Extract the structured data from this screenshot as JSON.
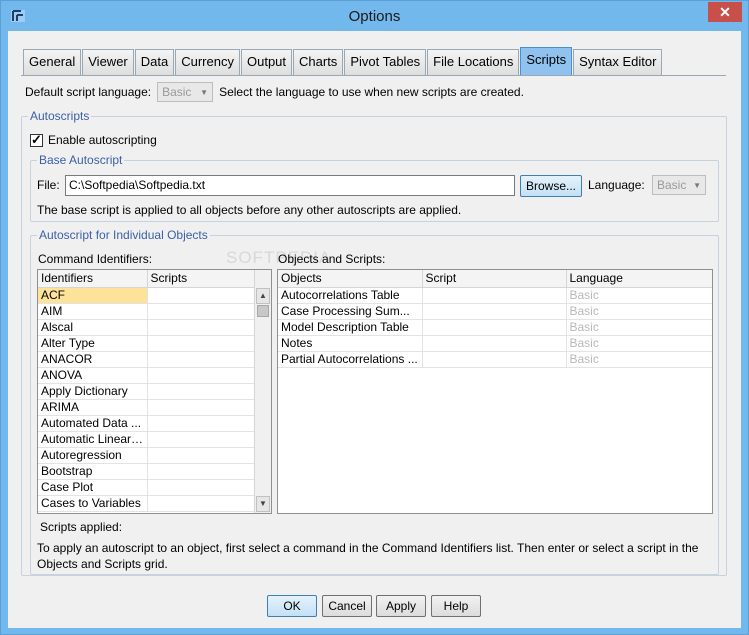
{
  "window": {
    "title": "Options",
    "close_symbol": "✕"
  },
  "tabs": [
    "General",
    "Viewer",
    "Data",
    "Currency",
    "Output",
    "Charts",
    "Pivot Tables",
    "File Locations",
    "Scripts",
    "Syntax Editor"
  ],
  "active_tab": "Scripts",
  "default_script": {
    "label": "Default script language:",
    "value": "Basic",
    "hint": "Select the language to use when new scripts are created."
  },
  "autoscripts": {
    "group_label": "Autoscripts",
    "enable_label": "Enable autoscripting",
    "enabled": true
  },
  "base_autoscript": {
    "group_label": "Base Autoscript",
    "file_label": "File:",
    "file_value": "C:\\Softpedia\\Softpedia.txt",
    "browse_label": "Browse...",
    "language_label": "Language:",
    "language_value": "Basic",
    "note": "The base script is applied to all objects before any other autoscripts are applied."
  },
  "individual": {
    "group_label": "Autoscript for Individual Objects",
    "cmd_label": "Command Identifiers:",
    "cmd_columns": [
      "Identifiers",
      "Scripts"
    ],
    "cmd_rows": [
      {
        "id": "ACF",
        "script": ""
      },
      {
        "id": "AIM",
        "script": ""
      },
      {
        "id": "Alscal",
        "script": ""
      },
      {
        "id": "Alter Type",
        "script": ""
      },
      {
        "id": "ANACOR",
        "script": ""
      },
      {
        "id": "ANOVA",
        "script": ""
      },
      {
        "id": "Apply Dictionary",
        "script": ""
      },
      {
        "id": "ARIMA",
        "script": ""
      },
      {
        "id": "Automated Data ...",
        "script": ""
      },
      {
        "id": "Automatic Linear ...",
        "script": ""
      },
      {
        "id": "Autoregression",
        "script": ""
      },
      {
        "id": "Bootstrap",
        "script": ""
      },
      {
        "id": "Case Plot",
        "script": ""
      },
      {
        "id": "Cases to Variables",
        "script": ""
      }
    ],
    "obj_label": "Objects and Scripts:",
    "obj_columns": [
      "Objects",
      "Script",
      "Language"
    ],
    "obj_rows": [
      {
        "object": "Autocorrelations Table",
        "script": "",
        "language": "Basic"
      },
      {
        "object": "Case Processing Sum...",
        "script": "",
        "language": "Basic"
      },
      {
        "object": "Model Description Table",
        "script": "",
        "language": "Basic"
      },
      {
        "object": "Notes",
        "script": "",
        "language": "Basic"
      },
      {
        "object": "Partial Autocorrelations ...",
        "script": "",
        "language": "Basic"
      }
    ],
    "applied_label": "Scripts applied:",
    "instructions": "To apply an autoscript to an object, first select a command in the Command Identifiers list. Then enter or select a script in the Objects and Scripts grid."
  },
  "buttons": {
    "ok": "OK",
    "cancel": "Cancel",
    "apply": "Apply",
    "help": "Help"
  },
  "watermark": "SOFTPEDIA"
}
